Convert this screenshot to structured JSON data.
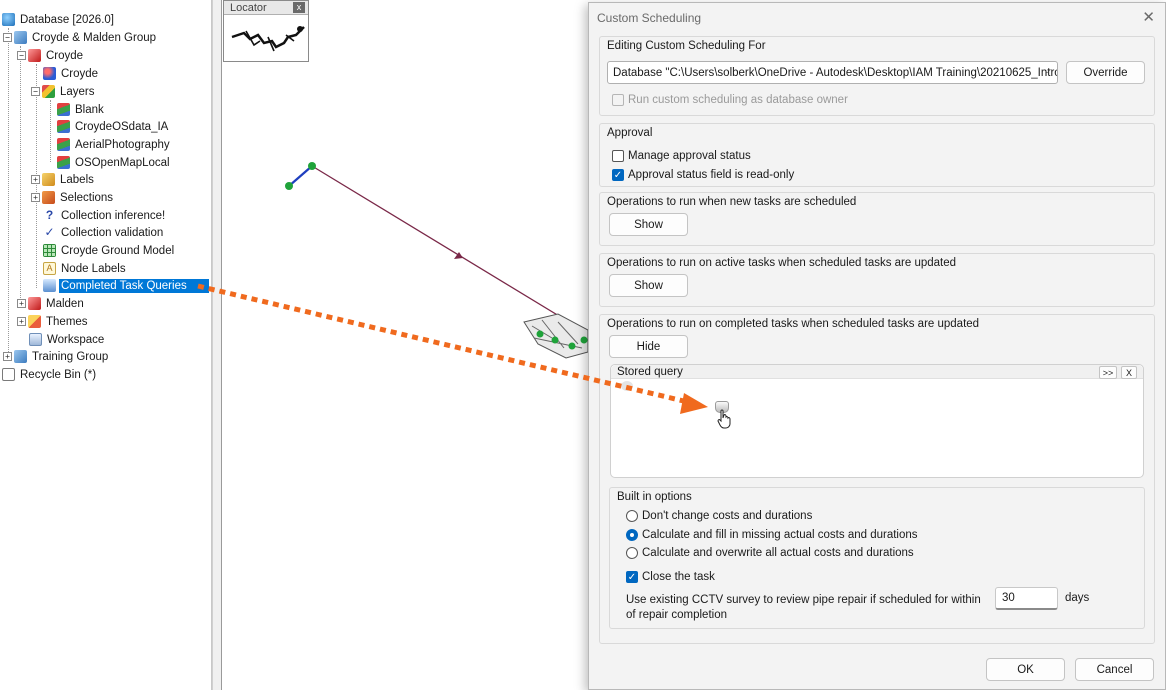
{
  "tree": {
    "database": "Database [2026.0]",
    "group": "Croyde & Malden Group",
    "network": "Croyde",
    "croyde": "Croyde",
    "layers": "Layers",
    "layer_items": [
      "Blank",
      "CroydeOSdata_IA",
      "AerialPhotography",
      "OSOpenMapLocal"
    ],
    "labels": "Labels",
    "selections": "Selections",
    "collection_inference": "Collection inference!",
    "collection_validation": "Collection validation",
    "ground_model": "Croyde Ground Model",
    "node_labels": "Node Labels",
    "completed_task_queries": "Completed Task Queries",
    "malden": "Malden",
    "themes": "Themes",
    "workspace": "Workspace",
    "training_group": "Training Group",
    "recycle_bin": "Recycle Bin (*)"
  },
  "locator": {
    "title": "Locator",
    "close": "x"
  },
  "dialog": {
    "title": "Custom Scheduling",
    "close": "✕",
    "editing": {
      "title": "Editing Custom Scheduling For",
      "combo_value": "Database \"C:\\Users\\solberk\\OneDrive - Autodesk\\Desktop\\IAM Training\\20210625_Intro",
      "override": "Override",
      "run_as_owner": "Run custom scheduling as database owner"
    },
    "approval": {
      "title": "Approval",
      "manage": "Manage approval status",
      "manage_checked": false,
      "readonly": "Approval status field is read-only",
      "readonly_checked": true
    },
    "ops_new": {
      "title": "Operations to run when new tasks are scheduled",
      "button": "Show"
    },
    "ops_active": {
      "title": "Operations to run on active tasks when scheduled tasks are updated",
      "button": "Show"
    },
    "ops_completed": {
      "title": "Operations to run on completed tasks when scheduled tasks are updated",
      "button": "Hide",
      "stored_query": "Stored query",
      "expand": ">>",
      "remove": "X"
    },
    "builtin": {
      "title": "Built in options",
      "options": [
        "Don't change costs and durations",
        "Calculate and fill in missing actual costs and durations",
        "Calculate and overwrite all actual costs and durations"
      ],
      "selected_index": 1,
      "close_task": "Close the task",
      "close_task_checked": true,
      "cctv_line1": "Use existing CCTV survey to review pipe repair if scheduled for within",
      "cctv_line2": "of repair completion",
      "days_value": "30",
      "days_unit": "days"
    },
    "ok": "OK",
    "cancel": "Cancel"
  },
  "colors": {
    "accent": "#0067c0",
    "selection": "#0078d7",
    "drag_arrow": "#f06a1e",
    "pipe": "#7a2848",
    "node": "#1fa33a"
  }
}
